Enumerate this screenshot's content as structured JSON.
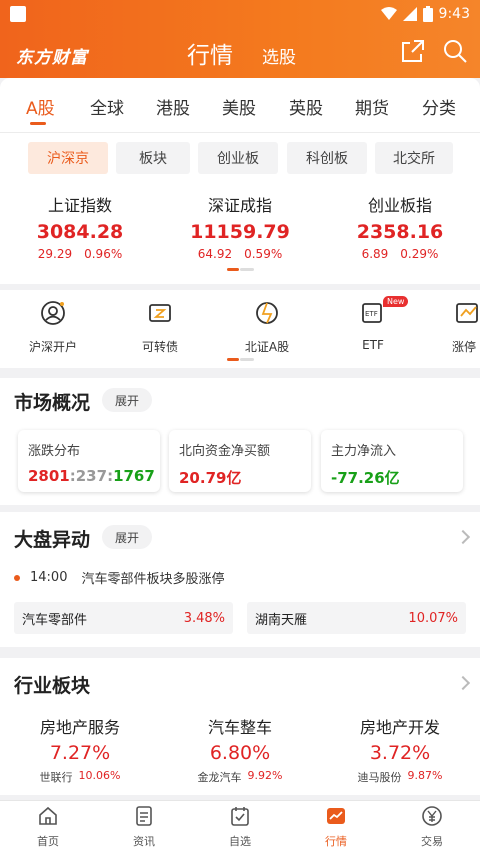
{
  "status_bar": {
    "time": "9:43"
  },
  "header": {
    "logo": "东方财富",
    "title": "行情",
    "subtitle": "选股"
  },
  "market_tabs": [
    "A股",
    "全球",
    "港股",
    "美股",
    "英股",
    "期货",
    "分类"
  ],
  "sub_tabs": [
    "沪深京",
    "板块",
    "创业板",
    "科创板",
    "北交所"
  ],
  "indices": [
    {
      "name": "上证指数",
      "value": "3084.28",
      "change": "29.29",
      "pct": "0.96%"
    },
    {
      "name": "深证成指",
      "value": "11159.79",
      "change": "64.92",
      "pct": "0.59%"
    },
    {
      "name": "创业板指",
      "value": "2358.16",
      "change": "6.89",
      "pct": "0.29%"
    }
  ],
  "quick_entries": [
    {
      "label": "沪深开户",
      "icon": "account-open-icon"
    },
    {
      "label": "可转债",
      "icon": "bond-icon"
    },
    {
      "label": "北证A股",
      "icon": "bse-icon"
    },
    {
      "label": "ETF",
      "icon": "etf-icon",
      "badge": "New"
    },
    {
      "label": "涨停",
      "icon": "limit-up-icon"
    }
  ],
  "market_overview": {
    "title": "市场概况",
    "expand": "展开",
    "cards": [
      {
        "title": "涨跌分布",
        "up": "2801",
        "sep1": ":",
        "flat": "237",
        "sep2": ":",
        "down": "1767"
      },
      {
        "title": "北向资金净买额",
        "value": "20.79亿"
      },
      {
        "title": "主力净流入",
        "value": "-77.26亿"
      }
    ]
  },
  "market_movers": {
    "title": "大盘异动",
    "expand": "展开",
    "alert_time": "14:00",
    "alert_text": "汽车零部件板块多股涨停",
    "stocks": [
      {
        "name": "汽车零部件",
        "pct": "3.48%"
      },
      {
        "name": "湖南天雁",
        "pct": "10.07%"
      }
    ]
  },
  "industry": {
    "title": "行业板块",
    "items": [
      {
        "name": "房地产服务",
        "pct": "7.27%",
        "lead": "世联行",
        "lead_pct": "10.06%"
      },
      {
        "name": "汽车整车",
        "pct": "6.80%",
        "lead": "金龙汽车",
        "lead_pct": "9.92%"
      },
      {
        "name": "房地产开发",
        "pct": "3.72%",
        "lead": "迪马股份",
        "lead_pct": "9.87%"
      }
    ]
  },
  "bottom_nav": [
    {
      "label": "首页",
      "icon": "home-icon"
    },
    {
      "label": "资讯",
      "icon": "news-icon"
    },
    {
      "label": "自选",
      "icon": "watchlist-icon"
    },
    {
      "label": "行情",
      "icon": "market-icon"
    },
    {
      "label": "交易",
      "icon": "trade-icon"
    }
  ],
  "colors": {
    "brand": "#f0641c",
    "up": "#e02424",
    "down": "#18a018"
  }
}
